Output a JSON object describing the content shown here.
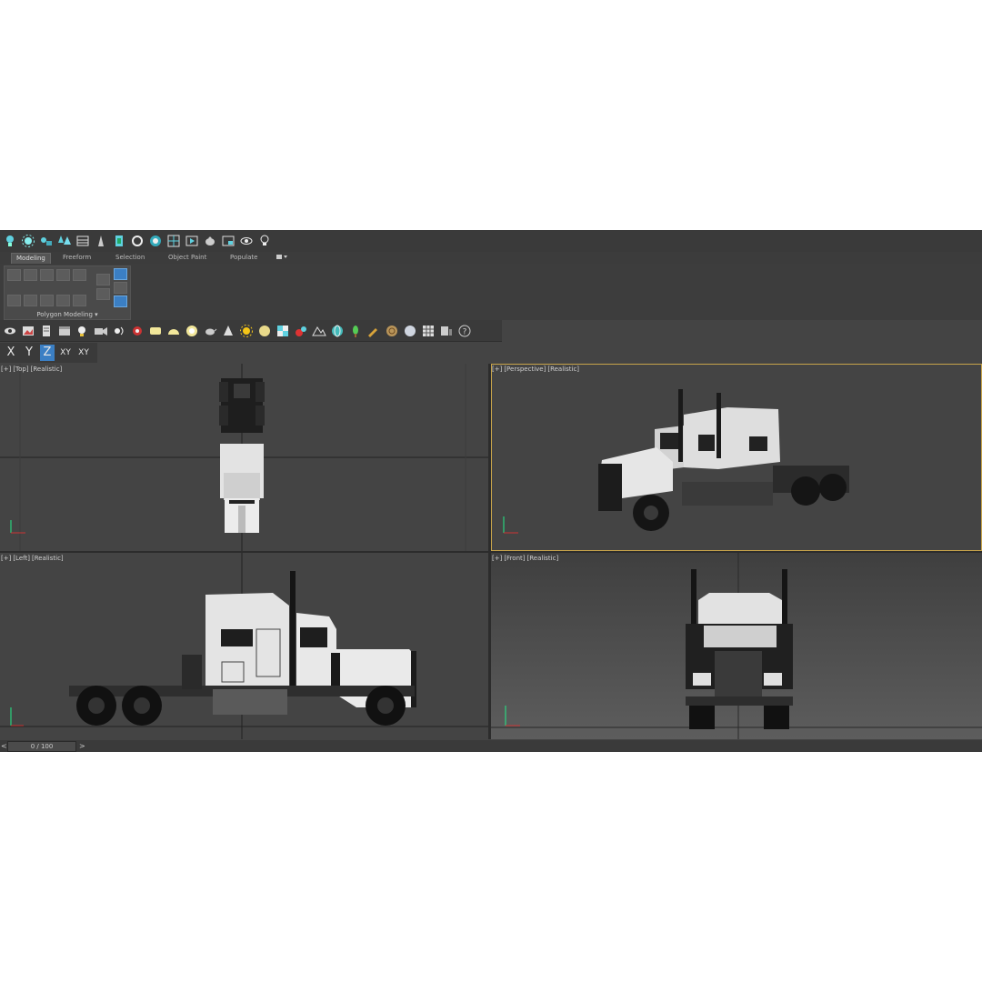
{
  "main_toolbar": {
    "icons": [
      "lightbulb-icon",
      "sun-icon",
      "particles-icon",
      "trees-icon",
      "table-icon",
      "bottle-icon",
      "tree-icon",
      "rotate-icon",
      "render-icon",
      "viewport-icon",
      "render-frame-icon",
      "teapot-render-icon",
      "fullscreen-icon",
      "eye-icon",
      "bulb-icon"
    ]
  },
  "ribbon": {
    "tabs": [
      "Modeling",
      "Freeform",
      "Selection",
      "Object Paint",
      "Populate"
    ],
    "active_tab": "Modeling",
    "group_label": "Polygon Modeling"
  },
  "toolbar2": {
    "icons": [
      "eye-icon",
      "image-icon",
      "sheet-icon",
      "calendar-icon",
      "light-icon",
      "camera-bubble-icon",
      "sound-icon",
      "helper-icon",
      "rect-light-icon",
      "dome-icon",
      "ring-icon",
      "teapot-icon",
      "cone-icon",
      "sun-icon",
      "sphere-icon",
      "checker-icon",
      "paint-icon",
      "terrain-icon",
      "globe-icon",
      "plant-icon",
      "brush-icon",
      "shell-icon",
      "material-sphere-icon",
      "grid-icon",
      "layers-icon",
      "help-icon"
    ]
  },
  "axis_constraints": {
    "x": "X",
    "y": "Y",
    "z": "Z",
    "xy": "XY",
    "xy_cycle": "XY",
    "active": "Z"
  },
  "viewports": {
    "top": {
      "plus": "[+]",
      "view": "[Top]",
      "shading": "[Realistic]"
    },
    "perspective": {
      "plus": "[+]",
      "view": "[Perspective]",
      "shading": "[Realistic]"
    },
    "left": {
      "plus": "[+]",
      "view": "[Left]",
      "shading": "[Realistic]"
    },
    "front": {
      "plus": "[+]",
      "view": "[Front]",
      "shading": "[Realistic]"
    }
  },
  "timeline": {
    "prev": "<",
    "frame": "0 / 100",
    "next": ">"
  },
  "colors": {
    "accent": "#3b7fc4",
    "active_viewport_border": "#c8a44a",
    "viewport_bg": "#444444"
  }
}
